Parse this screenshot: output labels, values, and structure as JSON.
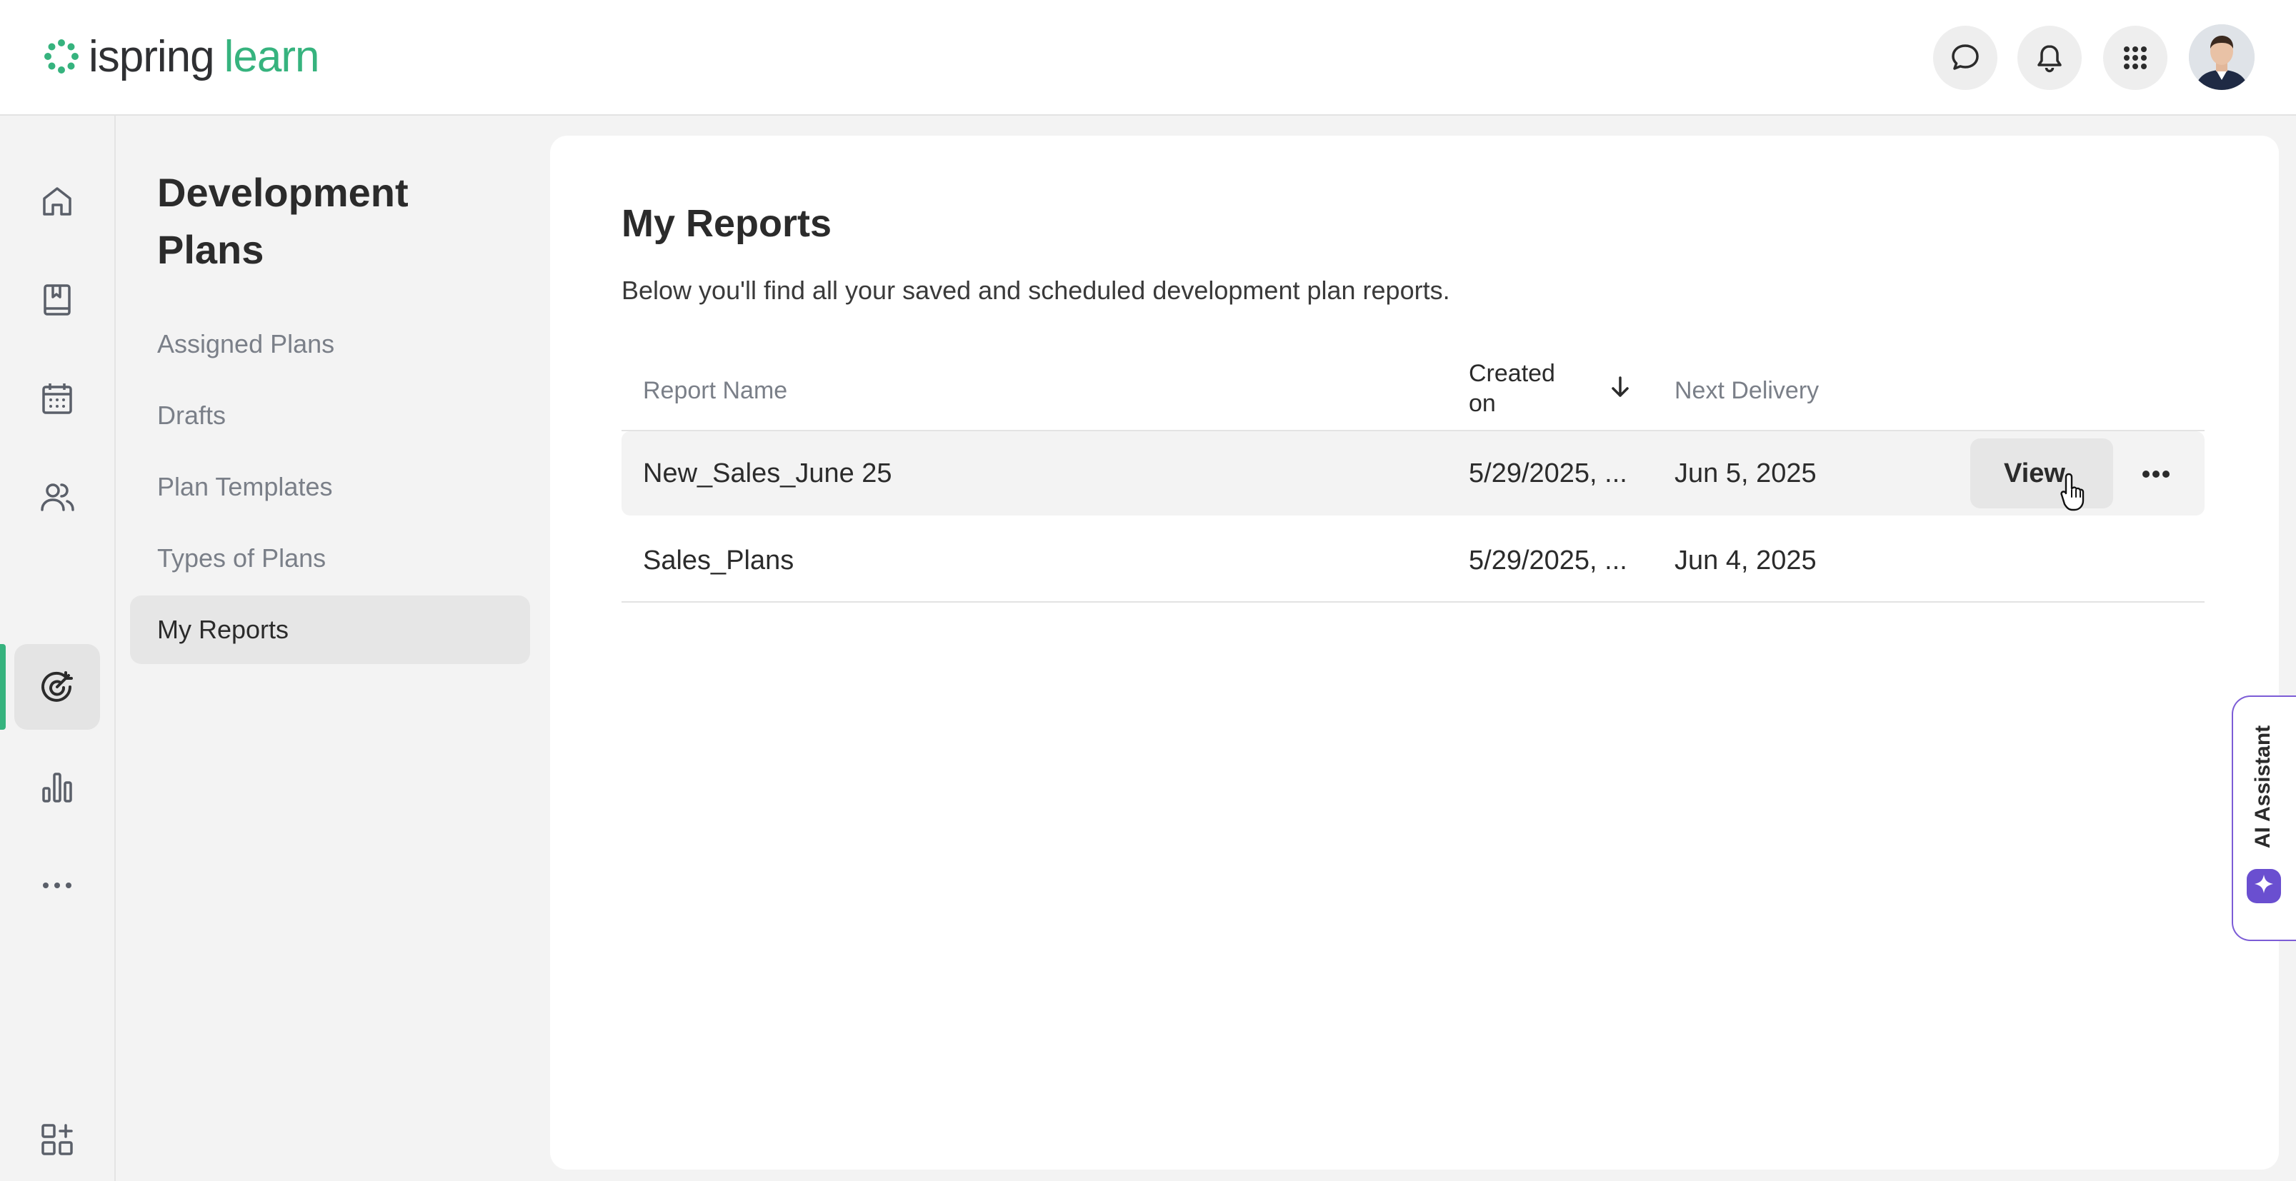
{
  "header": {
    "logo_word1": "ispring",
    "logo_word2": "learn",
    "brand_color": "#36b37e",
    "icons": [
      "chat-icon",
      "bell-icon",
      "apps-grid-icon"
    ]
  },
  "rail": {
    "items": [
      "home-icon",
      "book-icon",
      "calendar-icon",
      "people-icon",
      "target-icon",
      "bar-chart-icon",
      "more-icon",
      "add-widget-icon"
    ],
    "active": "target-icon"
  },
  "subnav": {
    "title": "Development Plans",
    "items": [
      {
        "label": "Assigned Plans"
      },
      {
        "label": "Drafts"
      },
      {
        "label": "Plan Templates"
      },
      {
        "label": "Types of Plans"
      },
      {
        "label": "My Reports"
      }
    ],
    "active": "My Reports"
  },
  "main": {
    "title": "My Reports",
    "description": "Below you'll find all your saved and scheduled development plan reports.",
    "columns": {
      "report_name": "Report Name",
      "created_line1": "Created",
      "created_line2": "on",
      "next_delivery": "Next Delivery"
    },
    "rows": [
      {
        "name": "New_Sales_June 25",
        "created": "5/29/2025, ...",
        "next": "Jun 5, 2025"
      },
      {
        "name": "Sales_Plans",
        "created": "5/29/2025, ...",
        "next": "Jun 4, 2025"
      }
    ],
    "view_label": "View"
  },
  "ai_assistant": {
    "label": "AI Assistant",
    "accent": "#7c5cd6"
  }
}
